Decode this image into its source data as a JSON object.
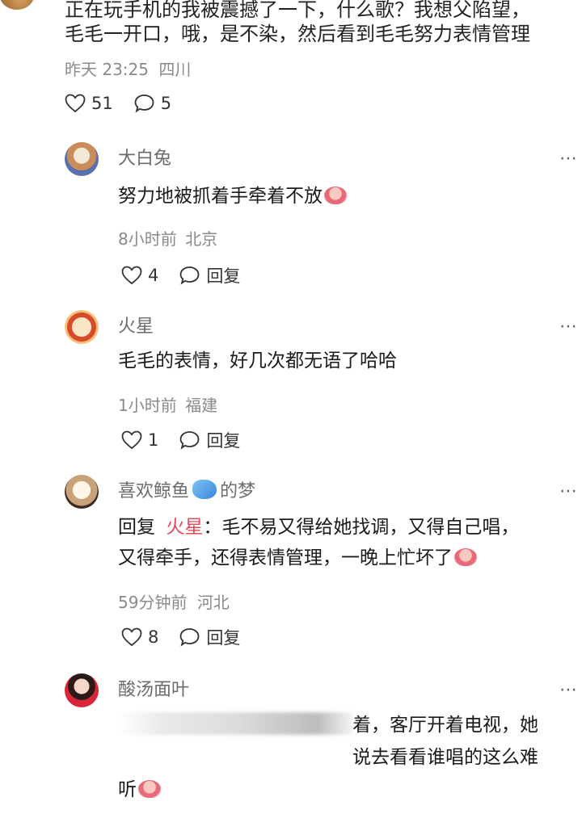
{
  "top_comment": {
    "line1": "正在玩手机的我被震撼了一下，什么歌？我想父陷望，",
    "line2": "毛毛一开口，哦，是不染，然后看到毛毛努力表情管理",
    "time": "昨天 23:25",
    "location": "四川",
    "likes": "51",
    "replies": "5"
  },
  "replies": [
    {
      "name": "大白兔",
      "text": "努力地被抓着手牵着不放",
      "time": "8小时前",
      "location": "北京",
      "likes": "4",
      "reply_label": "回复"
    },
    {
      "name": "火星",
      "text": "毛毛的表情，好几次都无语了哈哈",
      "time": "1小时前",
      "location": "福建",
      "likes": "1",
      "reply_label": "回复"
    },
    {
      "name_part1": "喜欢鲸鱼",
      "name_part2": "的梦",
      "reply_prefix": "回复",
      "mention": "火星",
      "line1": "：毛不易又得给她找调，又得自己唱，",
      "line2": "又得牵手，还得表情管理，一晚上忙坏了",
      "time": "59分钟前",
      "location": "河北",
      "likes": "8",
      "reply_label": "回复"
    },
    {
      "name": "酸汤面叶",
      "line1_visible": "着，客厅开着电视，她",
      "line2": "说去看看谁唱的这么难",
      "line3": "听"
    }
  ],
  "icons": {
    "like": "heart-outline-icon",
    "comment": "speech-bubble-icon",
    "more": "more-dots-icon"
  },
  "colors": {
    "meta_gray": "#8a8a8a",
    "name_gray": "#6b6b6b",
    "mention_red": "#e24a5a"
  }
}
